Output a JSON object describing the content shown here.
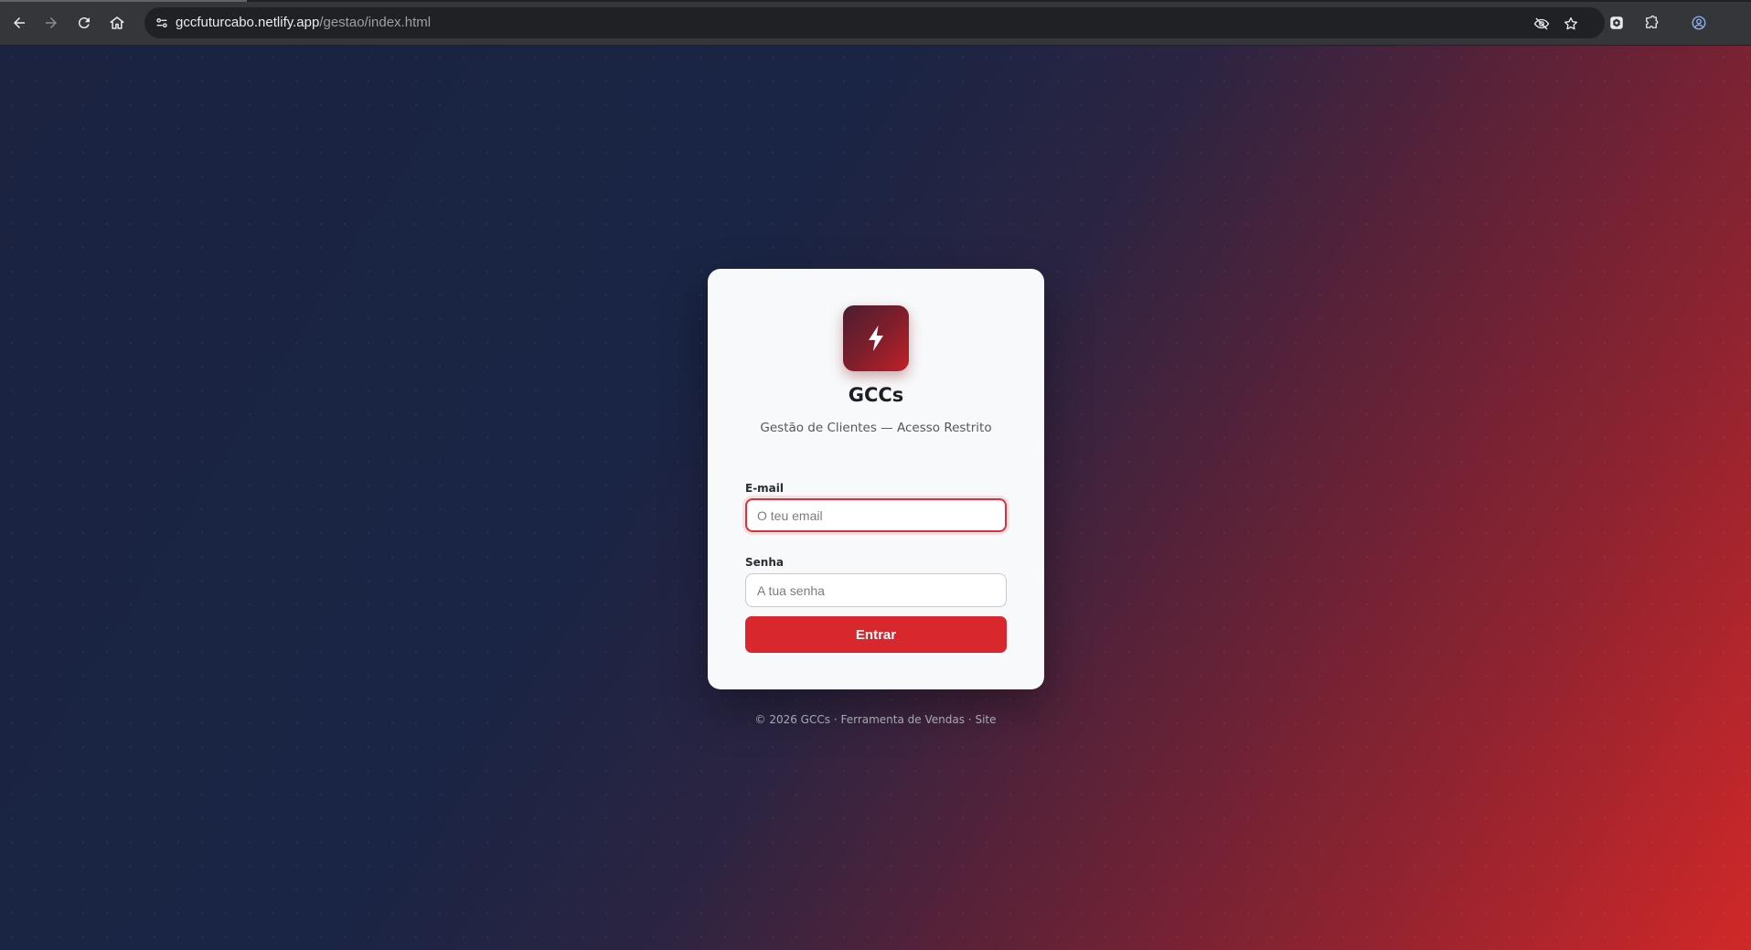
{
  "browser": {
    "url_host": "gccfuturcabo.netlify.app",
    "url_path": "/gestao/index.html",
    "icons": [
      "back-icon",
      "forward-icon",
      "reload-icon",
      "home-icon",
      "site-info-icon",
      "eye-off-icon",
      "star-icon",
      "extension-app-icon",
      "extensions-puzzle-icon",
      "profile-icon"
    ]
  },
  "brand": {
    "logo_icon": "lightning-bolt-icon",
    "title": "GCCs",
    "subtitle": "Gestão de Clientes — Acesso Restrito"
  },
  "form": {
    "email_label": "E-mail",
    "email_placeholder": "O teu email",
    "email_value": "",
    "password_label": "Senha",
    "password_placeholder": "A tua senha",
    "password_value": "",
    "submit_label": "Entrar"
  },
  "footer": {
    "copyright": "© 2026 GCCs",
    "separator": "·",
    "tool_link": "Ferramenta de Vendas",
    "site_link": "Site"
  },
  "colors": {
    "accent": "#d8272d",
    "focus_border": "#d9323a",
    "card_bg": "#f8f9fa",
    "bg_dark": "#1b2341",
    "bg_red": "#d12828"
  }
}
